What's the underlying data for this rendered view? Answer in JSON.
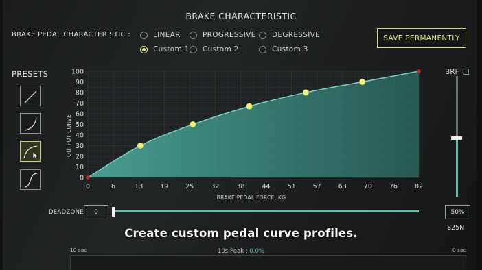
{
  "title": "BRAKE CHARACTERISTIC",
  "pedal_characteristic": {
    "label": "BRAKE PEDAL CHARACTERISTIC :",
    "options": [
      {
        "label": "LINEAR",
        "selected": false
      },
      {
        "label": "PROGRESSIVE",
        "selected": false
      },
      {
        "label": "DEGRESSIVE",
        "selected": false
      },
      {
        "label": "Custom 1",
        "selected": true
      },
      {
        "label": "Custom 2",
        "selected": false
      },
      {
        "label": "Custom 3",
        "selected": false
      }
    ]
  },
  "save_button": "SAVE PERMANENTLY",
  "presets": {
    "label": "PRESETS",
    "items": [
      "linear-curve-icon",
      "progressive-curve-icon",
      "degressive-curve-icon",
      "s-curve-icon"
    ],
    "active_index": 2
  },
  "brf": {
    "label": "BRF",
    "info": "i",
    "level": 0.5
  },
  "deadzone": {
    "label": "DEADZONE",
    "value": "0"
  },
  "percent": "50%",
  "force": "825N",
  "caption": "Create custom pedal curve profiles.",
  "monitor": {
    "left_label": "10 sec",
    "right_label": "0 sec",
    "peak_label": "10s Peak :",
    "peak_value": "0.0%"
  },
  "colors": {
    "accent": "#eef07a",
    "teal": "#64bfb0",
    "grid": "#3c4344"
  },
  "chart_data": {
    "type": "area",
    "xlabel": "BRAKE PEDAL FORCE, KG",
    "ylabel": "OUTPUT CURVE",
    "x_ticks": [
      "0",
      "6",
      "13",
      "19",
      "25",
      "32",
      "38",
      "44",
      "51",
      "57",
      "63",
      "70",
      "76",
      "82"
    ],
    "y_ticks": [
      "0",
      "10",
      "20",
      "30",
      "40",
      "50",
      "60",
      "70",
      "80",
      "90",
      "100"
    ],
    "xlim": [
      0,
      82
    ],
    "ylim": [
      0,
      100
    ],
    "grid": true,
    "control_points": [
      {
        "x": 13,
        "y": 30
      },
      {
        "x": 26,
        "y": 50
      },
      {
        "x": 40,
        "y": 67
      },
      {
        "x": 54,
        "y": 80
      },
      {
        "x": 68,
        "y": 90
      }
    ],
    "endpoints": [
      {
        "x": 0,
        "y": 0
      },
      {
        "x": 82,
        "y": 100
      }
    ]
  }
}
